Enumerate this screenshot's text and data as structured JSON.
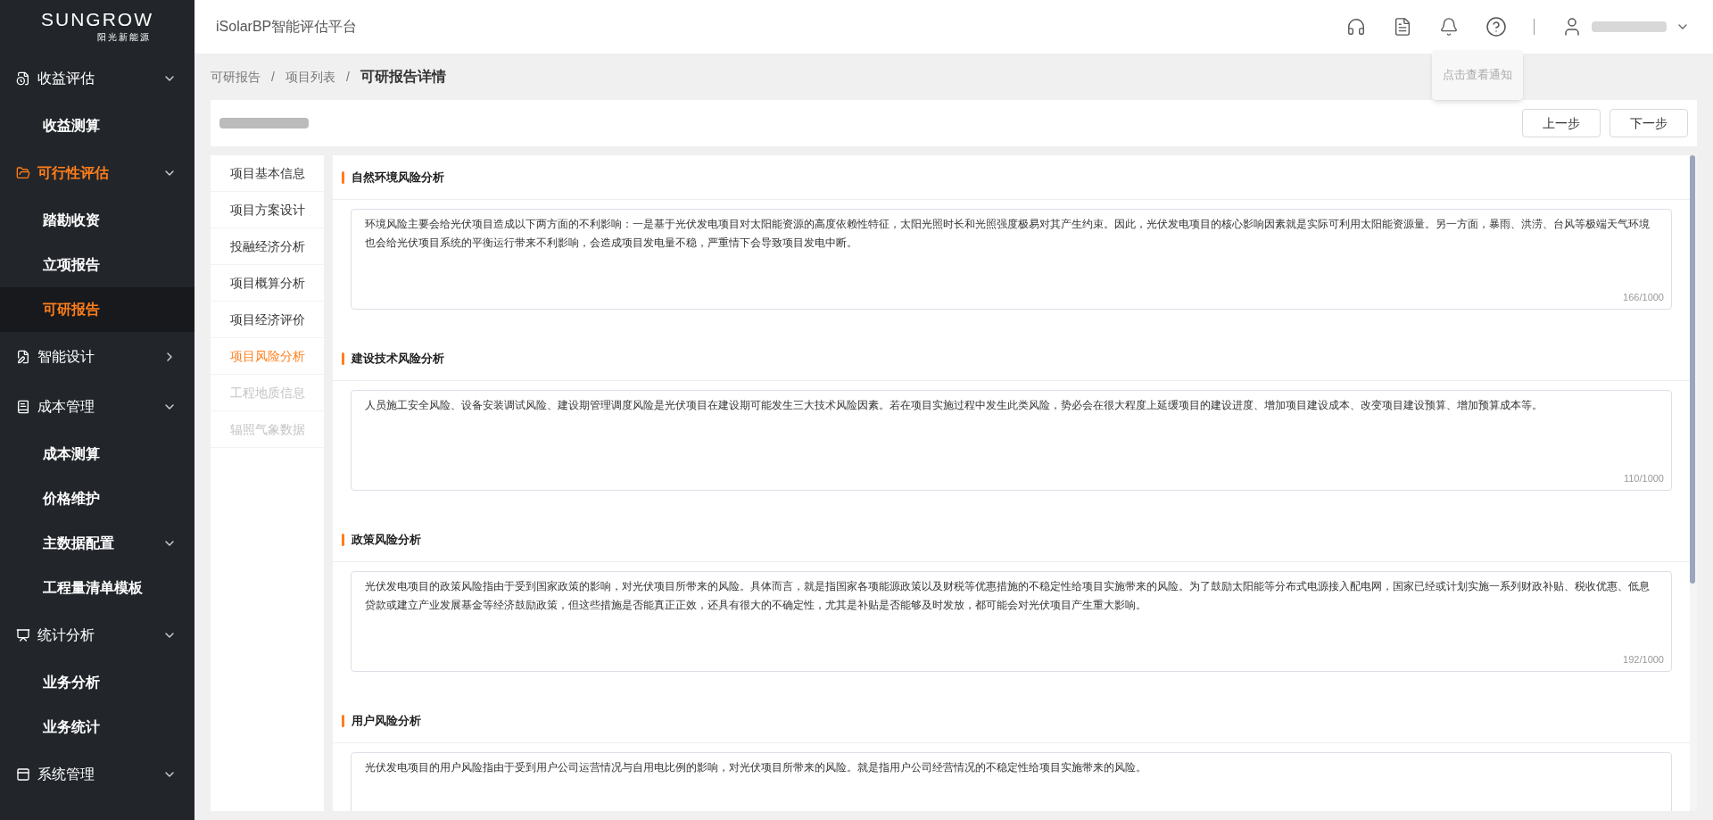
{
  "brand": {
    "name": "SUNGROW",
    "tagline": "阳光新能源"
  },
  "sidebar": {
    "items": [
      {
        "label": "收益评估",
        "expanded": true,
        "selected": false,
        "children": [
          {
            "label": "收益测算",
            "selected": false
          }
        ]
      },
      {
        "label": "可行性评估",
        "expanded": true,
        "selected": true,
        "children": [
          {
            "label": "踏勘收资",
            "selected": false
          },
          {
            "label": "立项报告",
            "selected": false
          },
          {
            "label": "可研报告",
            "selected": true
          }
        ]
      },
      {
        "label": "智能设计",
        "expanded": false,
        "selected": false
      },
      {
        "label": "成本管理",
        "expanded": true,
        "selected": false,
        "children": [
          {
            "label": "成本测算",
            "selected": false
          },
          {
            "label": "价格维护",
            "selected": false
          },
          {
            "label": "主数据配置",
            "selected": false,
            "expanded": true,
            "children": [
              {
                "label": "工程量清单模板",
                "selected": false
              }
            ]
          }
        ]
      },
      {
        "label": "统计分析",
        "expanded": true,
        "selected": false,
        "children": [
          {
            "label": "业务分析",
            "selected": false
          },
          {
            "label": "业务统计",
            "selected": false
          }
        ]
      },
      {
        "label": "系统管理",
        "expanded": true,
        "selected": false
      }
    ]
  },
  "header": {
    "title": "iSolarBP智能评估平台",
    "tooltip": "点击查看通知"
  },
  "breadcrumb": [
    {
      "label": "可研报告",
      "current": false
    },
    {
      "separator": "/",
      "label": "项目列表",
      "current": false
    },
    {
      "separator": "/",
      "label": "可研报告详情",
      "current": true
    }
  ],
  "toolbar": {
    "buttons": [
      "上一步",
      "下一步"
    ]
  },
  "section_nav": [
    {
      "label": "项目基本信息",
      "selected": false,
      "disabled": false
    },
    {
      "label": "项目方案设计",
      "selected": false,
      "disabled": false
    },
    {
      "label": "投融经济分析",
      "selected": false,
      "disabled": false
    },
    {
      "label": "项目概算分析",
      "selected": false,
      "disabled": false
    },
    {
      "label": "项目经济评价",
      "selected": false,
      "disabled": false
    },
    {
      "label": "项目风险分析",
      "selected": true,
      "disabled": false
    },
    {
      "label": "工程地质信息",
      "selected": false,
      "disabled": true
    },
    {
      "label": "辐照气象数据",
      "selected": false,
      "disabled": true
    }
  ],
  "sections": [
    {
      "title": "自然环境风险分析",
      "value": "环境风险主要会给光伏项目造成以下两方面的不利影响：一是基于光伏发电项目对太阳能资源的高度依赖性特征，太阳光照时长和光照强度极易对其产生约束。因此，光伏发电项目的核心影响因素就是实际可利用太阳能资源量。另一方面，暴雨、洪涝、台风等极端天气环境也会给光伏项目系统的平衡运行带来不利影响，会造成项目发电量不稳，严重情下会导致项目发电中断。",
      "count": "166/1000"
    },
    {
      "title": "建设技术风险分析",
      "value": "人员施工安全风险、设备安装调试风险、建设期管理调度风险是光伏项目在建设期可能发生三大技术风险因素。若在项目实施过程中发生此类风险，势必会在很大程度上延缓项目的建设进度、增加项目建设成本、改变项目建设预算、增加预算成本等。",
      "count": "110/1000"
    },
    {
      "title": "政策风险分析",
      "value": "光伏发电项目的政策风险指由于受到国家政策的影响，对光伏项目所带来的风险。具体而言，就是指国家各项能源政策以及财税等优惠措施的不稳定性给项目实施带来的风险。为了鼓励太阳能等分布式电源接入配电网，国家已经或计划实施一系列财政补贴、税收优惠、低息贷款或建立产业发展基金等经济鼓励政策，但这些措施是否能真正正效，还具有很大的不确定性，尤其是补贴是否能够及时发放，都可能会对光伏项目产生重大影响。",
      "count": "192/1000"
    },
    {
      "title": "用户风险分析",
      "value": "光伏发电项目的用户风险指由于受到用户公司运营情况与自用电比例的影响，对光伏项目所带来的风险。就是指用户公司经营情况的不稳定性给项目实施带来的风险。"
    }
  ]
}
